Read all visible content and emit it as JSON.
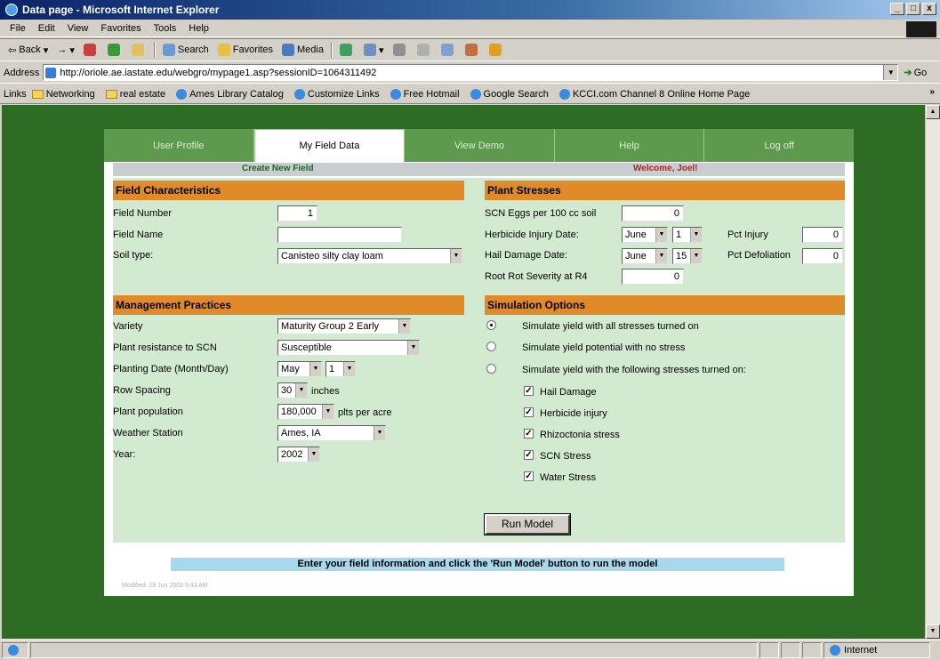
{
  "window": {
    "title": "Data page - Microsoft Internet Explorer",
    "min": "_",
    "max": "□",
    "close": "x"
  },
  "menu": [
    "File",
    "Edit",
    "View",
    "Favorites",
    "Tools",
    "Help"
  ],
  "toolbar": {
    "back": "Back",
    "forward": "→",
    "search": "Search",
    "favorites": "Favorites",
    "media": "Media"
  },
  "address": {
    "label": "Address",
    "url": "http://oriole.ae.iastate.edu/webgro/mypage1.asp?sessionID=1064311492",
    "go": "Go"
  },
  "links": {
    "label": "Links",
    "items": [
      "Networking",
      "real estate",
      "Ames Library Catalog",
      "Customize Links",
      "Free Hotmail",
      "Google Search",
      "KCCI.com Channel 8 Online Home Page"
    ]
  },
  "tabs": [
    "User Profile",
    "My Field Data",
    "View Demo",
    "Help",
    "Log off"
  ],
  "bar": {
    "create": "Create New Field",
    "welcome": "Welcome, Joel!"
  },
  "field": {
    "heading": "Field Characteristics",
    "number_label": "Field Number",
    "number_value": "1",
    "name_label": "Field Name",
    "name_value": "",
    "soil_label": "Soil type:",
    "soil_value": "Canisteo silty clay loam"
  },
  "stress": {
    "heading": "Plant Stresses",
    "scn_label": "SCN Eggs per 100 cc soil",
    "scn_value": "0",
    "herb_label": "Herbicide Injury Date:",
    "herb_month": "June",
    "herb_day": "1",
    "pct_injury_label": "Pct Injury",
    "pct_injury_value": "0",
    "hail_label": "Hail Damage Date:",
    "hail_month": "June",
    "hail_day": "15",
    "pct_defol_label": "Pct Defoliation",
    "pct_defol_value": "0",
    "rootrot_label": "Root Rot Severity at R4",
    "rootrot_value": "0"
  },
  "mgmt": {
    "heading": "Management Practices",
    "variety_label": "Variety",
    "variety_value": "Maturity Group 2 Early",
    "resist_label": "Plant resistance to SCN",
    "resist_value": "Susceptible",
    "plant_label": "Planting Date (Month/Day)",
    "plant_month": "May",
    "plant_day": "1",
    "row_label": "Row Spacing",
    "row_value": "30",
    "row_unit": "inches",
    "pop_label": "Plant population",
    "pop_value": "180,000",
    "pop_unit": "plts per acre",
    "weather_label": "Weather Station",
    "weather_value": "Ames, IA",
    "year_label": "Year:",
    "year_value": "2002"
  },
  "sim": {
    "heading": "Simulation Options",
    "opt1": "Simulate yield with all stresses turned on",
    "opt2": "Simulate yield potential with no stress",
    "opt3": "Simulate yield with the following stresses turned on:",
    "checks": [
      "Hail Damage",
      "Herbicide injury",
      "Rhizoctonia stress",
      "SCN Stress",
      "Water Stress"
    ],
    "run": "Run Model"
  },
  "info": "Enter your field information and click the 'Run Model' button to run the model",
  "modified": "Modified: 29 Jun 2003 9:43 AM",
  "status": {
    "zone": "Internet"
  }
}
